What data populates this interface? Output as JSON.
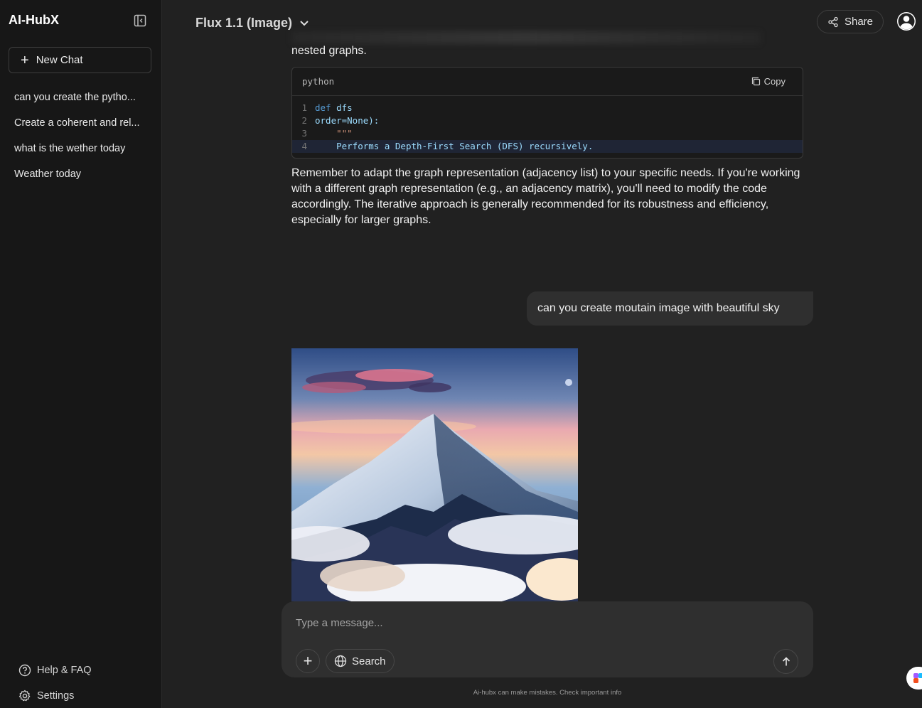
{
  "sidebar": {
    "brand": "AI-HubX",
    "new_chat_label": "New Chat",
    "history": [
      {
        "label": "can you create the pytho..."
      },
      {
        "label": "Create a coherent and rel..."
      },
      {
        "label": "what is the wether today"
      },
      {
        "label": "Weather today"
      }
    ],
    "footer": {
      "help_label": "Help & FAQ",
      "settings_label": "Settings"
    }
  },
  "header": {
    "model_name": "Flux 1.1 (Image)",
    "share_label": "Share"
  },
  "conversation": {
    "assistant_text_1": "nested graphs.",
    "code_block": {
      "language": "python",
      "copy_label": "Copy",
      "lines": [
        {
          "num": "1",
          "keyword": "def",
          "rest": "dfs"
        },
        {
          "num": "2",
          "text": "order=None):"
        },
        {
          "num": "3",
          "text": "\"\"\""
        },
        {
          "num": "4",
          "text": "Performs a Depth-First Search (DFS) recursively."
        }
      ]
    },
    "assistant_text_2": "Remember to adapt the graph representation (adjacency list) to your specific needs. If you're working with a different graph representation (e.g., an adjacency matrix), you'll need to modify the code accordingly. The iterative approach is generally recommended for its robustness and efficiency, especially for larger graphs.",
    "user_message": "can you create moutain image with beautiful sky"
  },
  "composer": {
    "placeholder": "Type a message...",
    "search_label": "Search",
    "disclaimer": "Ai-hubx can make mistakes. Check important info"
  },
  "colors": {
    "background": "#212121",
    "sidebar": "#171717",
    "bubble": "#2f2f2f",
    "code_keyword": "#569cd6"
  }
}
